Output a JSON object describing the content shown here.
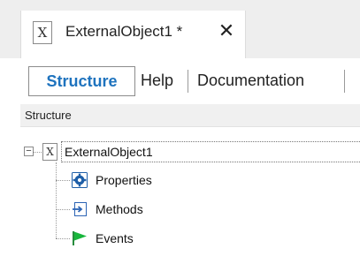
{
  "document_tab": {
    "icon": "external-object-icon",
    "icon_glyph": "X",
    "title": "ExternalObject1 *",
    "close_glyph": "✕"
  },
  "subtabs": [
    {
      "label": "Structure",
      "active": true
    },
    {
      "label": "Help",
      "active": false
    },
    {
      "label": "Documentation",
      "active": false
    }
  ],
  "panel": {
    "header": "Structure"
  },
  "tree": {
    "root": {
      "toggle_glyph": "−",
      "icon": "external-object-icon",
      "icon_glyph": "X",
      "label": "ExternalObject1"
    },
    "children": [
      {
        "label": "Properties",
        "icon": "properties-gear-icon"
      },
      {
        "label": "Methods",
        "icon": "methods-icon"
      },
      {
        "label": "Events",
        "icon": "events-flag-icon"
      }
    ]
  },
  "colors": {
    "active_tab_text": "#1e73be",
    "properties_icon": "#1f5fa8",
    "methods_icon": "#2c64b4",
    "events_flag": "#18b63c"
  }
}
